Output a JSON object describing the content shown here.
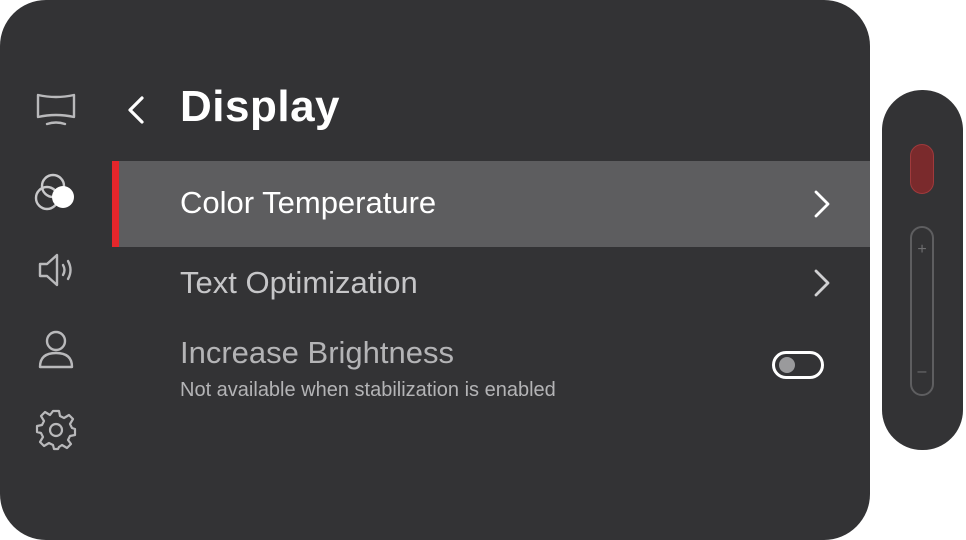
{
  "header": {
    "title": "Display"
  },
  "sidebar": {
    "items": [
      {
        "icon": "monitor-icon"
      },
      {
        "icon": "color-circles-icon",
        "active": true
      },
      {
        "icon": "speaker-icon"
      },
      {
        "icon": "user-icon"
      },
      {
        "icon": "gear-icon"
      }
    ]
  },
  "menu": {
    "items": [
      {
        "label": "Color Temperature",
        "selected": true
      },
      {
        "label": "Text Optimization"
      },
      {
        "label": "Increase Brightness",
        "sublabel": "Not available when stabilization is enabled",
        "toggle": false
      }
    ]
  },
  "remote": {
    "zoom_in": "+",
    "zoom_out": "–"
  },
  "colors": {
    "accent": "#e5262b",
    "panel": "#333335",
    "selected_row": "#5d5d5f",
    "disabled_text": "#b4b4b6"
  }
}
